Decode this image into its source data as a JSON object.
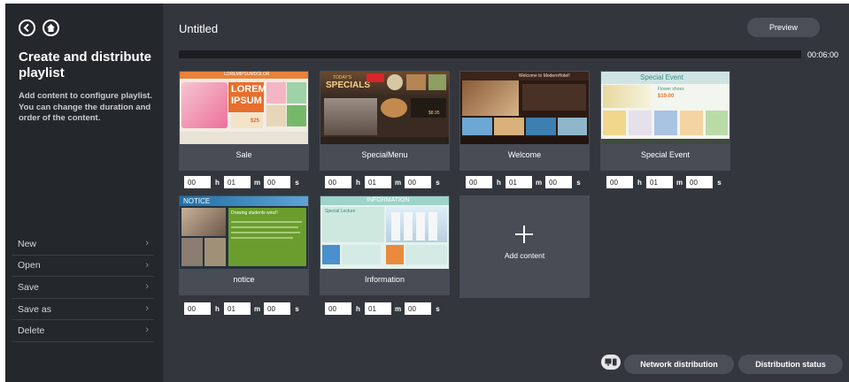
{
  "sidebar": {
    "title": "Create and distribute playlist",
    "description": "Add content to configure playlist. You can change the duration and order of the content.",
    "menu": [
      {
        "label": "New"
      },
      {
        "label": "Open"
      },
      {
        "label": "Save"
      },
      {
        "label": "Save as"
      },
      {
        "label": "Delete"
      }
    ]
  },
  "header": {
    "title": "Untitled",
    "preview_label": "Preview",
    "total_time": "00:06:00"
  },
  "units": {
    "h": "h",
    "m": "m",
    "s": "s"
  },
  "items": [
    {
      "name": "Sale",
      "h": "00",
      "m": "01",
      "s": "00",
      "thumb": {
        "line1": "LOREMIPSUMDOLOR",
        "line2": "LOREM",
        "line3": "IPSUM",
        "price": "$25"
      }
    },
    {
      "name": "SpecialMenu",
      "h": "00",
      "m": "01",
      "s": "00",
      "thumb": {
        "line1": "TODAY'S",
        "line2": "SPECIALS",
        "price": "$8.95"
      }
    },
    {
      "name": "Welcome",
      "h": "00",
      "m": "01",
      "s": "00",
      "thumb": {
        "line1": "Welcome to ModernHotel!"
      }
    },
    {
      "name": "Special Event",
      "h": "00",
      "m": "01",
      "s": "00",
      "thumb": {
        "line1": "Special Event",
        "line2": "Flower shoes",
        "price": "$19.00"
      }
    },
    {
      "name": "notice",
      "h": "00",
      "m": "01",
      "s": "00",
      "thumb": {
        "line1": "NOTICE",
        "line2": "Drawing students wins!!"
      }
    },
    {
      "name": "Information",
      "h": "00",
      "m": "01",
      "s": "00",
      "thumb": {
        "line1": "INFORMATION",
        "line2": "Special Lecture"
      }
    }
  ],
  "add_content_label": "Add content",
  "footer": {
    "network_label": "Network distribution",
    "status_label": "Distribution status",
    "device_icon": "device-icon"
  },
  "colors": {
    "background": "#33373d",
    "sidebar": "#24272c",
    "tile": "#474c55",
    "pill": "#4a4f57"
  }
}
